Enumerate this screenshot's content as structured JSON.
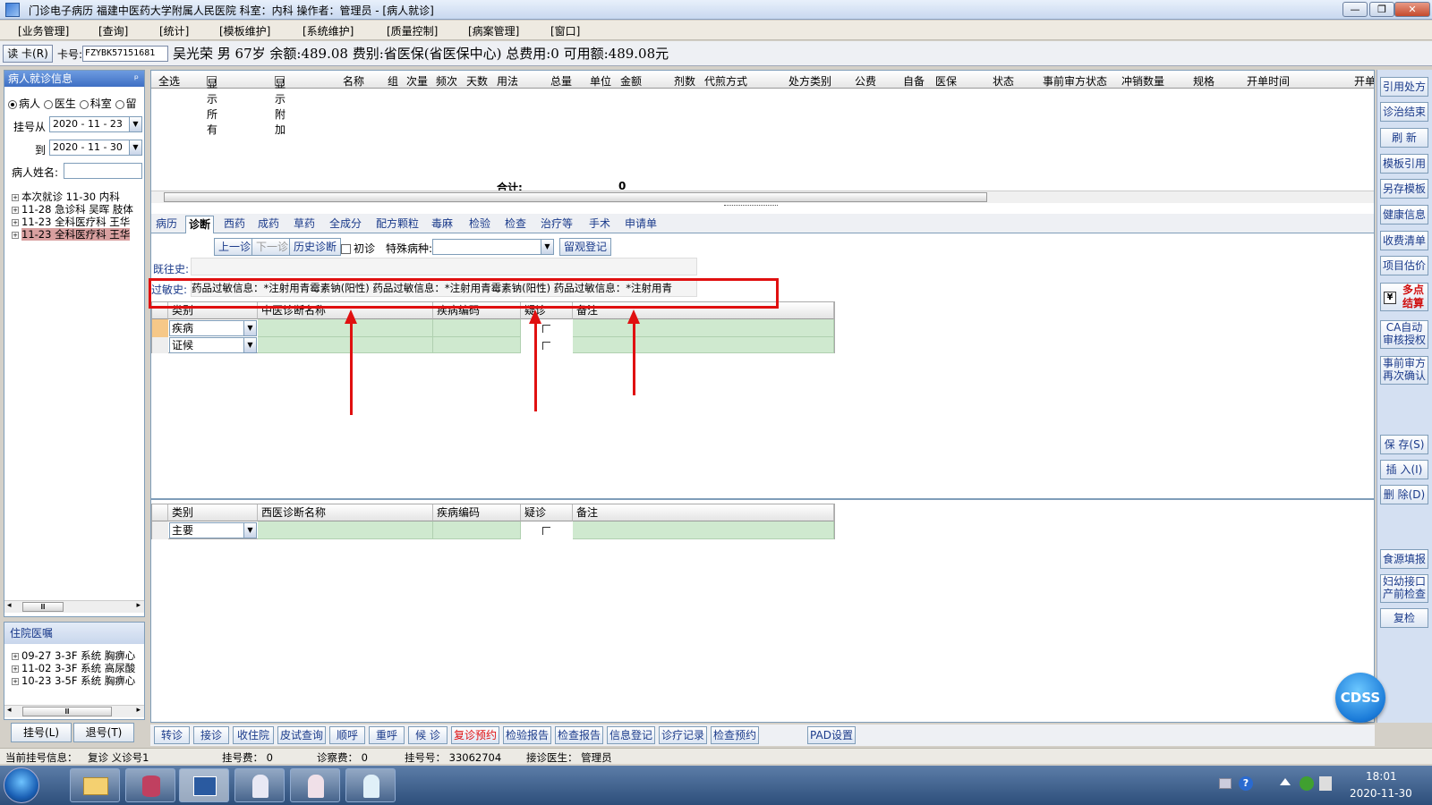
{
  "title": "门诊电子病历 福建中医药大学附属人民医院 科室：内科 操作者：管理员 - [病人就诊]",
  "window_controls": {
    "min": "—",
    "max": "❐",
    "close": "✕"
  },
  "menu": [
    "[业务管理]",
    "[查询]",
    "[统计]",
    "[模板维护]",
    "[系统维护]",
    "[质量控制]",
    "[病案管理]",
    "[窗口]"
  ],
  "patient": {
    "read_card": "读 卡(R)",
    "card_label": "卡号:",
    "card_no": "FZYBK57151681",
    "info": "吴光荣 男 67岁 余额:489.08 费别:省医保(省医保中心) 总费用:0 可用额:489.08元"
  },
  "left": {
    "header": "病人就诊信息",
    "pin": "ᵖ",
    "radios": [
      "病人",
      "医生",
      "科室",
      "留"
    ],
    "from_label": "挂号从",
    "from_date": "2020 - 11 - 23",
    "to_label": "到",
    "to_date": "2020 - 11 - 30",
    "name_label": "病人姓名:",
    "visits": [
      "本次就诊 11-30 内科",
      "11-28 急诊科 吴晖 肢体",
      "11-23 全科医疗科 王华",
      "11-23 全科医疗科 王华"
    ],
    "inpatient_header": "住院医嘱",
    "inpatient": [
      "09-27 3-3F 系统 胸痹心",
      "11-02 3-3F 系统 高尿酸",
      "10-23 3-5F 系统 胸痹心"
    ],
    "register_btn": "挂号(L)",
    "unregister_btn": "退号(T)",
    "scroll_left": "◂",
    "scroll_right": "▸",
    "scroll_thumb": "Ⅲ"
  },
  "columns": {
    "select_all": "全选",
    "show_all": "显示所有",
    "show_extra": "显示附加",
    "cols": [
      "名称",
      "组",
      "次量",
      "频次",
      "天数",
      "用法",
      "总量",
      "单位",
      "金额",
      "剂数",
      "代煎方式",
      "处方类别",
      "公费",
      "自备",
      "医保",
      "状态",
      "事前审方状态",
      "冲销数量",
      "规格",
      "开单时间",
      "开单"
    ]
  },
  "total_label": "合计:",
  "total_value": "0",
  "tabs": [
    "病历",
    "诊断",
    "西药",
    "成药",
    "草药",
    "全成分",
    "配方颗粒",
    "毒麻",
    "检验",
    "检查",
    "治疗等",
    "手术",
    "申请单"
  ],
  "diag": {
    "prev": "上一诊",
    "next": "下一诊",
    "history": "历史诊断",
    "first_visit": "初诊",
    "special_label": "特殊病种:",
    "observe": "留观登记",
    "past_label": "既往史:",
    "allergy_label": "过敏史:",
    "allergy_text": "药品过敏信息：*注射用青霉素钠(阳性) 药品过敏信息：*注射用青霉素钠(阳性) 药品过敏信息：*注射用青"
  },
  "tcm_grid": {
    "headers": [
      "类别",
      "中医诊断名称",
      "疾病编码",
      "疑诊",
      "备注"
    ],
    "rows": [
      "疾病",
      "证候"
    ]
  },
  "west_grid": {
    "headers": [
      "类别",
      "西医诊断名称",
      "疾病编码",
      "疑诊",
      "备注"
    ],
    "rows": [
      "主要"
    ]
  },
  "right_buttons": [
    "引用处方",
    "诊治结束",
    "刷 新",
    "模板引用",
    "另存模板",
    "健康信息",
    "收费清单",
    "项目估价",
    "多点结算",
    "CA自动审核授权",
    "事前审方再次确认",
    "保 存(S)",
    "插 入(I)",
    "删 除(D)",
    "食源填报",
    "妇幼接口产前检查",
    "复检"
  ],
  "bottom_buttons": [
    "转诊",
    "接诊",
    "收住院",
    "皮试查询",
    "顺呼",
    "重呼",
    "候 诊",
    "复诊预约",
    "检验报告",
    "检查报告",
    "信息登记",
    "诊疗记录",
    "检查预约",
    "PAD设置"
  ],
  "status": {
    "current_reg": "当前挂号信息：",
    "revisit": "复诊 义诊号1",
    "reg_fee": "挂号费： 0",
    "diag_fee": "诊察费： 0",
    "reg_no": "挂号号： 33062704",
    "doctor": "接诊医生： 管理员"
  },
  "cdss": "CDSS",
  "clock": {
    "time": "18:01",
    "date": "2020-11-30"
  }
}
